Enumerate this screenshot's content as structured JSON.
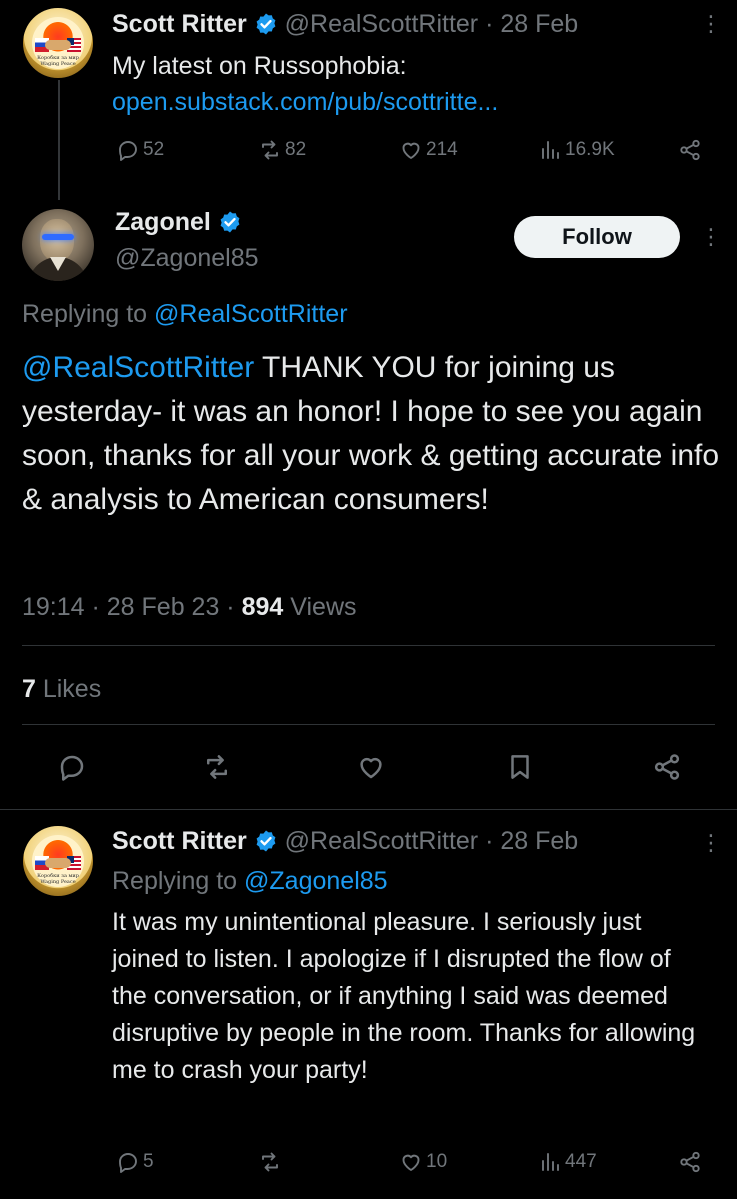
{
  "tweet1": {
    "name": "Scott Ritter",
    "handle": "@RealScottRitter",
    "date": "· 28 Feb",
    "text": "My latest on Russophobia:",
    "link": "open.substack.com/pub/scottritte...",
    "avatar_text": "Коробки за мир Waging Peace",
    "replies": "52",
    "reposts": "82",
    "likes": "214",
    "views": "16.9K"
  },
  "focus": {
    "name": "Zagonel",
    "handle": "@Zagonel85",
    "follow_label": "Follow",
    "replying_prefix": "Replying to ",
    "replying_handle": "@RealScottRitter",
    "mention": "@RealScottRitter",
    "body": " THANK YOU for joining us yesterday- it was an honor! I hope to see you again soon, thanks for all your work & getting accurate info & analysis to American consumers!",
    "timestamp": "19:14 · 28 Feb 23 · ",
    "views_count": "894",
    "views_label": " Views",
    "likes_count": "7",
    "likes_label": " Likes"
  },
  "tweet2": {
    "name": "Scott Ritter",
    "handle": "@RealScottRitter",
    "date": "· 28 Feb",
    "replying_prefix": "Replying to ",
    "replying_handle": "@Zagonel85",
    "text": "It was my unintentional pleasure. I seriously just joined to listen. I apologize if I disrupted the flow of the conversation, or if anything I said was deemed disruptive by people in the room. Thanks for allowing me to crash your party!",
    "replies": "5",
    "reposts": "",
    "likes": "10",
    "views": "447"
  },
  "icons": [
    "verified-badge-icon",
    "more-icon",
    "reply-icon",
    "repost-icon",
    "like-icon",
    "views-icon",
    "share-icon",
    "bookmark-icon"
  ],
  "colors": {
    "background": "#000000",
    "text": "#e7e9ea",
    "secondary": "#71767b",
    "accent": "#1d9bf0",
    "divider": "#2f3336"
  }
}
